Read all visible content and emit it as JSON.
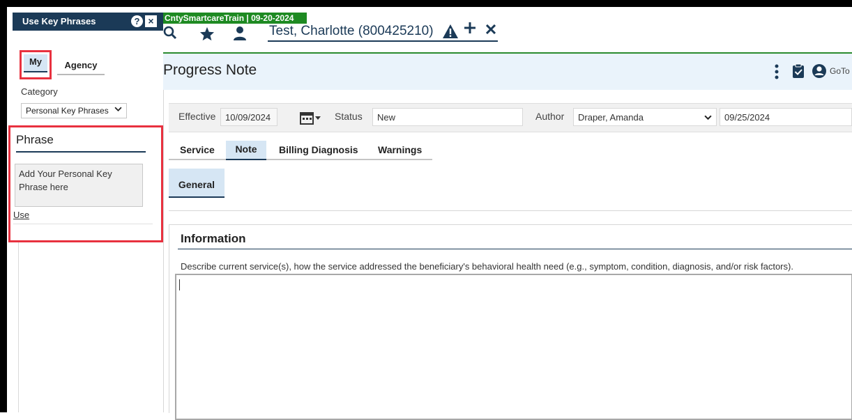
{
  "key_phrases_panel": {
    "title": "Use Key Phrases",
    "help_icon": "help-icon",
    "close_icon": "close-icon",
    "tabs": [
      {
        "label": "My",
        "active": true
      },
      {
        "label": "Agency",
        "active": false
      }
    ],
    "category_label": "Category",
    "category_value": "Personal Key Phrases",
    "phrase_header": "Phrase",
    "phrase_text": "Add Your Personal Key Phrase here",
    "use_link": "Use"
  },
  "environment_banner": "CntySmartcareTrain | 09-20-2024",
  "topbar": {
    "icons": [
      "search-icon",
      "star-icon",
      "user-icon"
    ],
    "client_name": "Test, Charlotte (800425210)",
    "client_actions": [
      "warning-icon",
      "plus-icon",
      "close-icon"
    ]
  },
  "page": {
    "title": "Progress Note",
    "right_actions": [
      "more-icon",
      "clipboard-icon",
      "account-icon"
    ],
    "right_text": "GoTo"
  },
  "filters": {
    "effective_label": "Effective",
    "effective_value": "10/09/2024",
    "status_label": "Status",
    "status_value": "New",
    "author_label": "Author",
    "author_value": "Draper, Amanda",
    "date_value": "09/25/2024"
  },
  "tabs": [
    {
      "label": "Service",
      "active": false
    },
    {
      "label": "Note",
      "active": true
    },
    {
      "label": "Billing Diagnosis",
      "active": false
    },
    {
      "label": "Warnings",
      "active": false
    }
  ],
  "subtab": "General",
  "information": {
    "title": "Information",
    "description": "Describe current service(s), how the service addressed the beneficiary's behavioral health need (e.g., symptom, condition, diagnosis, and/or risk factors).",
    "value": ""
  },
  "colors": {
    "header_navy": "#1b3a57",
    "env_green": "#1e8a22",
    "highlight_red": "#e8313f",
    "active_tab_blue": "#d6e6f4"
  }
}
